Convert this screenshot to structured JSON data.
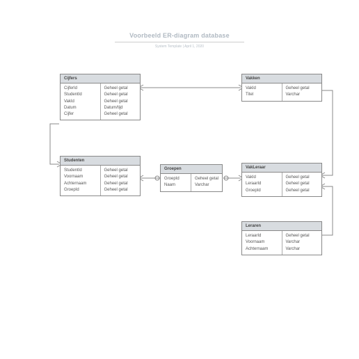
{
  "header": {
    "title": "Voorbeeld ER-diagram database",
    "subtitle": "System Template  |  April 1, 2020"
  },
  "entities": {
    "cijfers": {
      "name": "Cijfers",
      "fields": [
        "CijferId",
        "StudentId",
        "VakId",
        "Datum",
        "Cijfer"
      ],
      "types": [
        "Geheel getal",
        "Geheel getal",
        "Geheel getal",
        "Datum/tijd",
        "Geheel getal"
      ]
    },
    "vakken": {
      "name": "Vakken",
      "fields": [
        "VakId",
        "Titel"
      ],
      "types": [
        "Geheel getal",
        "Varchar"
      ]
    },
    "studenten": {
      "name": "Studenten",
      "fields": [
        "StudentId",
        "Voornaam",
        "Achternaam",
        "GroepId"
      ],
      "types": [
        "Geheel getal",
        "Geheel getal",
        "Geheel getal",
        "Geheel getal"
      ]
    },
    "groepen": {
      "name": "Groepen",
      "fields": [
        "GroepId",
        "Naam"
      ],
      "types": [
        "Geheel getal",
        "Varchar"
      ]
    },
    "vakleraar": {
      "name": "VakLeraar",
      "fields": [
        "VakId",
        "LeraarId",
        "GroepId"
      ],
      "types": [
        "Geheel getal",
        "Geheel getal",
        "Geheel getal"
      ]
    },
    "leraren": {
      "name": "Leraren",
      "fields": [
        "LeraarId",
        "Voornaam",
        "Achternaam"
      ],
      "types": [
        "Geheel getal",
        "Varchar",
        "Varchar"
      ]
    }
  }
}
